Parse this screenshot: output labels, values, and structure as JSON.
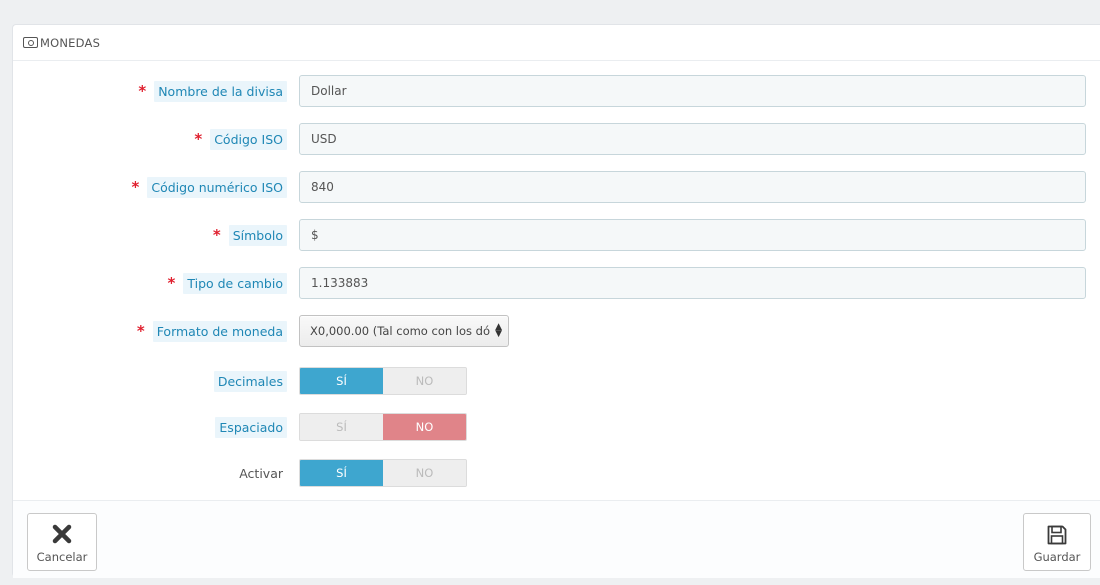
{
  "panel": {
    "title": "MONEDAS",
    "title_icon": "money-icon"
  },
  "fields": {
    "name": {
      "label": "Nombre de la divisa",
      "value": "Dollar",
      "required": true
    },
    "iso": {
      "label": "Código ISO",
      "value": "USD",
      "required": true
    },
    "iso_numeric": {
      "label": "Código numérico ISO",
      "value": "840",
      "required": true
    },
    "symbol": {
      "label": "Símbolo",
      "value": "$",
      "required": true
    },
    "rate": {
      "label": "Tipo de cambio",
      "value": "1.133883",
      "required": true
    },
    "format": {
      "label": "Formato de moneda",
      "value": "X0,000.00 (Tal como con los dó",
      "required": true
    }
  },
  "toggles": {
    "decimals": {
      "label": "Decimales",
      "yes": "SÍ",
      "no": "NO",
      "selected": "yes"
    },
    "spacing": {
      "label": "Espaciado",
      "yes": "SÍ",
      "no": "NO",
      "selected": "no"
    },
    "active": {
      "label": "Activar",
      "yes": "SÍ",
      "no": "NO",
      "selected": "yes"
    }
  },
  "footer": {
    "cancel_label": "Cancelar",
    "cancel_icon": "close-icon",
    "save_label": "Guardar",
    "save_icon": "floppy-disk-icon"
  },
  "colors": {
    "toggle_on": "#3ea6cf",
    "toggle_off_active": "#e08489",
    "required": "#e0202f",
    "label_text": "#1f87b5"
  }
}
